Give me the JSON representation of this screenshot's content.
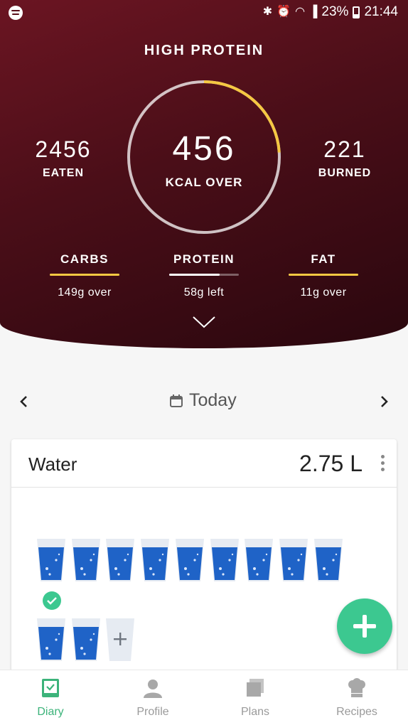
{
  "status_bar": {
    "battery": "23%",
    "time": "21:44",
    "icons": [
      "spotify-icon",
      "bluetooth-icon",
      "alarm-icon",
      "wifi-icon",
      "signal-icon",
      "battery-icon"
    ]
  },
  "header": {
    "plan_title": "HIGH PROTEIN",
    "kcal_value": "456",
    "kcal_label": "KCAL OVER",
    "eaten_value": "2456",
    "eaten_label": "EATEN",
    "burned_value": "221",
    "burned_label": "BURNED",
    "ring_progress": 0.24,
    "macros": [
      {
        "name": "CARBS",
        "status": "149g over",
        "fill": 1.0,
        "color": "#f5c842"
      },
      {
        "name": "PROTEIN",
        "status": "58g left",
        "fill": 0.72,
        "color": "#ffffff"
      },
      {
        "name": "FAT",
        "status": "11g over",
        "fill": 1.0,
        "color": "#f5c842"
      }
    ]
  },
  "date_nav": {
    "label": "Today"
  },
  "water": {
    "title": "Water",
    "amount": "2.75 L",
    "glasses_full": 11,
    "glasses_empty": 1
  },
  "bottom_nav": [
    {
      "label": "Diary",
      "icon": "diary-icon",
      "active": true
    },
    {
      "label": "Profile",
      "icon": "profile-icon",
      "active": false
    },
    {
      "label": "Plans",
      "icon": "plans-icon",
      "active": false
    },
    {
      "label": "Recipes",
      "icon": "recipes-icon",
      "active": false
    }
  ],
  "colors": {
    "header_dark": "#4a0e18",
    "accent_yellow": "#f5c842",
    "accent_green": "#3cc890",
    "water_blue": "#1f63c7"
  }
}
